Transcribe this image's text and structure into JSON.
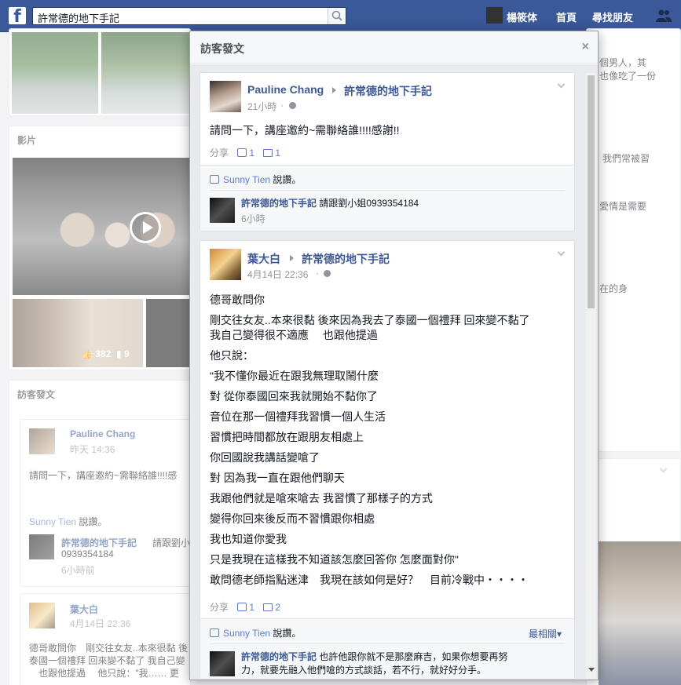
{
  "topbar": {
    "logo": "f",
    "search_value": "許常德的地下手記",
    "nav": {
      "profile": "楊筱体",
      "home": "首頁",
      "find_friends": "尋找朋友"
    }
  },
  "background": {
    "video_heading": "影片",
    "thumb_likes": "382",
    "thumb_comments": "9",
    "visitor_heading": "訪客發文",
    "post1": {
      "name": "Pauline Chang",
      "time": "昨天 14:36",
      "text": "請問一下，講座邀約~需聯絡誰!!!!感",
      "liker": "Sunny Tien",
      "like_suffix": "說讚。",
      "reply_name": "許常德的地下手記",
      "reply_text1": "請跟劉小",
      "reply_text2": "0939354184",
      "reply_time": "6小時前"
    },
    "post2": {
      "name": "葉大白",
      "time": "4月14日 22:36",
      "line1": "德哥敢問你　剛交往女友..本來很黏 後",
      "line2": "泰國一個禮拜 回來變不黏了 我自己變",
      "line3": "　也跟他提過　 他只說：\"我…… 更"
    },
    "right_snippets": [
      "個男人，其",
      "也像吃了一份",
      "我們常被習",
      "愛情是需要",
      "在的身"
    ]
  },
  "dialog": {
    "title": "訪客發文",
    "close": "×",
    "post1": {
      "author": "Pauline Chang",
      "page": "許常德的地下手記",
      "time": "21小時",
      "text": "請問一下，講座邀約~需聯絡誰!!!!感謝!!",
      "share": "分享",
      "likes": "1",
      "comments": "1",
      "liker": "Sunny Tien",
      "like_suffix": "說讚。",
      "reply": {
        "name": "許常德的地下手記",
        "text": "請跟劉小姐0939354184",
        "time": "6小時"
      }
    },
    "post2": {
      "author": "葉大白",
      "page": "許常德的地下手記",
      "time": "4月14日 22:36",
      "lines": [
        "德哥敢問你",
        "剛交往女友..本來很黏 後來因為我去了泰國一個禮拜 回來變不黏了",
        "我自己變得很不適應　  也跟他提過",
        "他只說：",
        "\"我不懂你最近在跟我無理取鬧什麼",
        "對 從你泰國回來我就開始不黏你了",
        "音位在那一個禮拜我習慣一個人生活",
        "習慣把時間都放在跟朋友相處上",
        "你回國說我講話變嗆了",
        "對 因為我一直在跟他們聊天",
        "我跟他們就是嗆來嗆去 我習慣了那樣子的方式",
        "變得你回來後反而不習慣跟你相處",
        "我也知道你愛我",
        "只是我現在這樣我不知道該怎麼回答你 怎麼面對你\"",
        "敢問德老師指點迷津　我現在該如何是好？　目前冷戰中・・・・"
      ],
      "share": "分享",
      "likes": "1",
      "comments": "2",
      "liker": "Sunny Tien",
      "like_suffix": "說讚。",
      "sort": "最相關▾",
      "reply": {
        "name": "許常德的地下手記",
        "text1": "也許他跟你就不是那麼麻吉，如果你想要再努",
        "text2": "力，就要先融入他們嗆的方式談話，若不行，就好好分手。"
      }
    }
  }
}
